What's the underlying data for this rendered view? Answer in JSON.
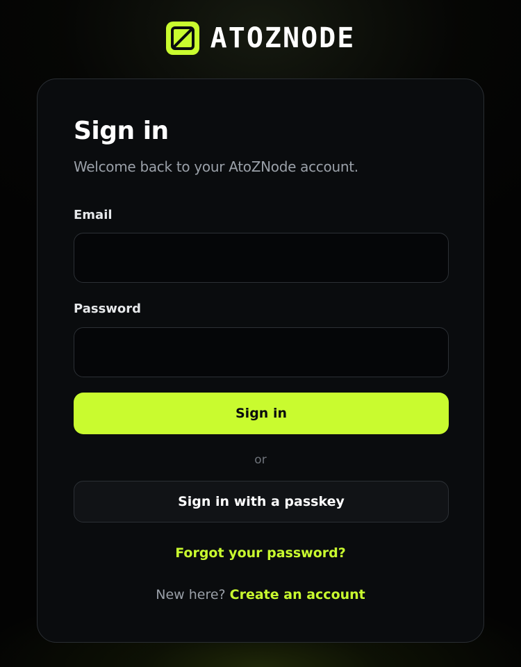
{
  "brand": {
    "name": "ATOZNODE",
    "logo_icon": "atoznode-logo-icon",
    "accent_color": "#c9fb2f"
  },
  "card": {
    "title": "Sign in",
    "subtitle": "Welcome back to your AtoZNode account.",
    "email": {
      "label": "Email",
      "value": "",
      "placeholder": ""
    },
    "password": {
      "label": "Password",
      "value": "",
      "placeholder": ""
    },
    "submit_label": "Sign in",
    "divider_text": "or",
    "passkey_label": "Sign in with a passkey",
    "forgot_label": "Forgot your password?",
    "signup_prompt": "New here?",
    "signup_link": "Create an account"
  },
  "colors": {
    "background": "#030303",
    "card": "#0a0c0e",
    "muted_text": "#9aa0a8",
    "accent": "#c9fb2f"
  }
}
